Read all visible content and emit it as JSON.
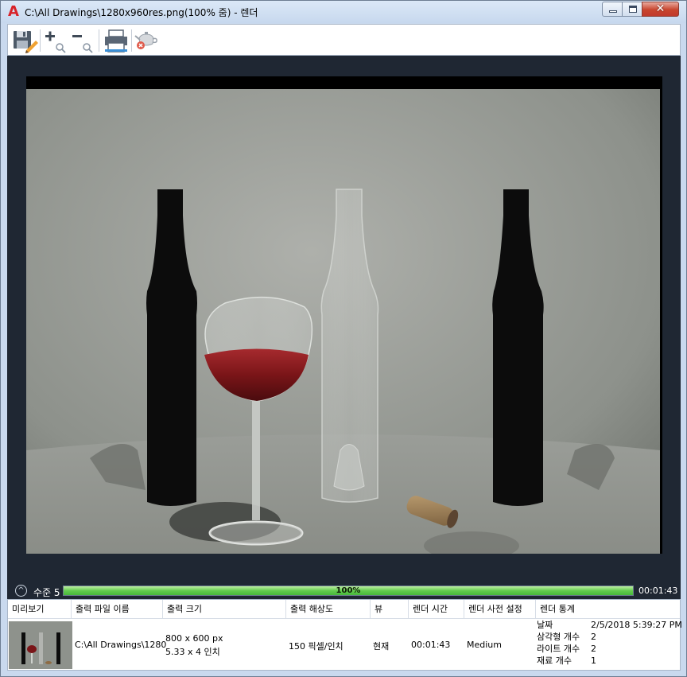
{
  "window": {
    "title": "C:\\All Drawings\\1280x960res.png(100% 줌) - 렌더",
    "app_icon": "autocad-a-icon",
    "close_glyph": "✕"
  },
  "toolbar": {
    "items": [
      {
        "name": "save-icon"
      },
      {
        "name": "zoom-in-icon"
      },
      {
        "name": "zoom-out-icon"
      },
      {
        "name": "print-icon"
      },
      {
        "name": "cancel-render-teapot-icon"
      }
    ]
  },
  "status": {
    "level_label": "수준 5",
    "progress_value": 1.0,
    "progress_text": "100%",
    "elapsed": "00:01:43",
    "expand_glyph": "^"
  },
  "stats": {
    "headers": [
      "미리보기",
      "출력 파일 이름",
      "출력 크기",
      "출력 해상도",
      "뷰",
      "렌더 시간",
      "렌더 사전 설정",
      "렌더 통계"
    ],
    "row": {
      "filename": "C:\\All Drawings\\1280",
      "size_px": "800 x 600 px",
      "size_in": "5.33 x 4 인치",
      "resolution": "150 픽셀/인치",
      "view": "현재",
      "render_time": "00:01:43",
      "preset": "Medium",
      "stats": [
        {
          "label": "날짜",
          "value": "2/5/2018 5:39:27 PM"
        },
        {
          "label": "삼각형 개수",
          "value": "2"
        },
        {
          "label": "라이트 개수",
          "value": "2"
        },
        {
          "label": "재료 개수",
          "value": "1"
        }
      ]
    }
  },
  "colors": {
    "accent_progress": "#5fcb4c",
    "viewport_bg": "#1f2733",
    "close_button": "#c8442d"
  }
}
